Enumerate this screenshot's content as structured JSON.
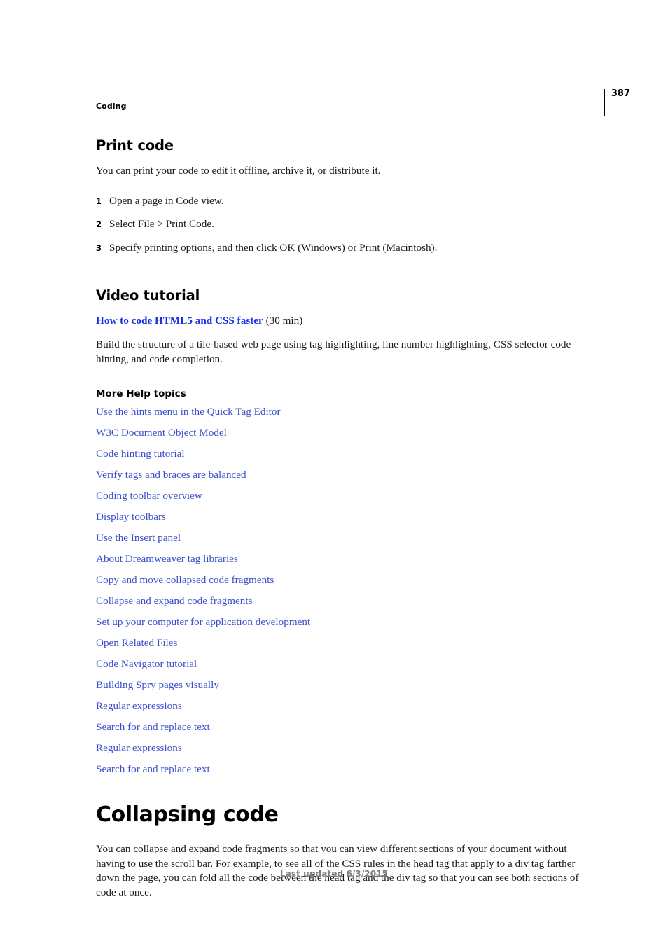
{
  "header": {
    "running_head": "Coding",
    "page_number": "387"
  },
  "sections": {
    "print_code": {
      "title": "Print code",
      "intro": "You can print your code to edit it offline, archive it, or distribute it.",
      "steps": [
        {
          "number": "1",
          "text": "Open a page in Code view."
        },
        {
          "number": "2",
          "text": "Select File > Print Code."
        },
        {
          "number": "3",
          "text": "Specify printing options, and then click OK (Windows) or Print (Macintosh)."
        }
      ]
    },
    "video_tutorial": {
      "title": "Video tutorial",
      "link_label": "How to code HTML5 and CSS faster",
      "duration": "(30 min)",
      "description": "Build the structure of a tile-based web page using tag highlighting, line number highlighting, CSS selector code hinting, and code completion."
    },
    "more_help": {
      "title": "More Help topics",
      "links": [
        "Use the hints menu in the Quick Tag Editor",
        "W3C Document Object Model",
        "Code hinting tutorial",
        "Verify tags and braces are balanced",
        "Coding toolbar overview",
        "Display toolbars",
        "Use the Insert panel",
        "About Dreamweaver tag libraries",
        "Copy and move collapsed code fragments",
        "Collapse and expand code fragments",
        "Set up your computer for application development",
        "Open Related Files",
        "Code Navigator tutorial",
        "Building Spry pages visually",
        "Regular expressions",
        "Search for and replace text",
        "Regular expressions",
        "Search for and replace text"
      ]
    },
    "collapsing_code": {
      "title": "Collapsing code",
      "body": "You can collapse and expand code fragments so that you can view different sections of your document without having to use the scroll bar. For example, to see all of the CSS rules in the head tag that apply to a div tag farther down the page, you can fold all the code between the head tag and the div tag so that you can see both sections of code at once."
    }
  },
  "footer": {
    "last_updated": "Last updated 6/3/2015"
  },
  "colors": {
    "link_blue": "#3a4fcd",
    "video_link_blue": "#1a2de8",
    "footer_gray": "#7d7d7d",
    "text_black": "#1a1a1a"
  }
}
